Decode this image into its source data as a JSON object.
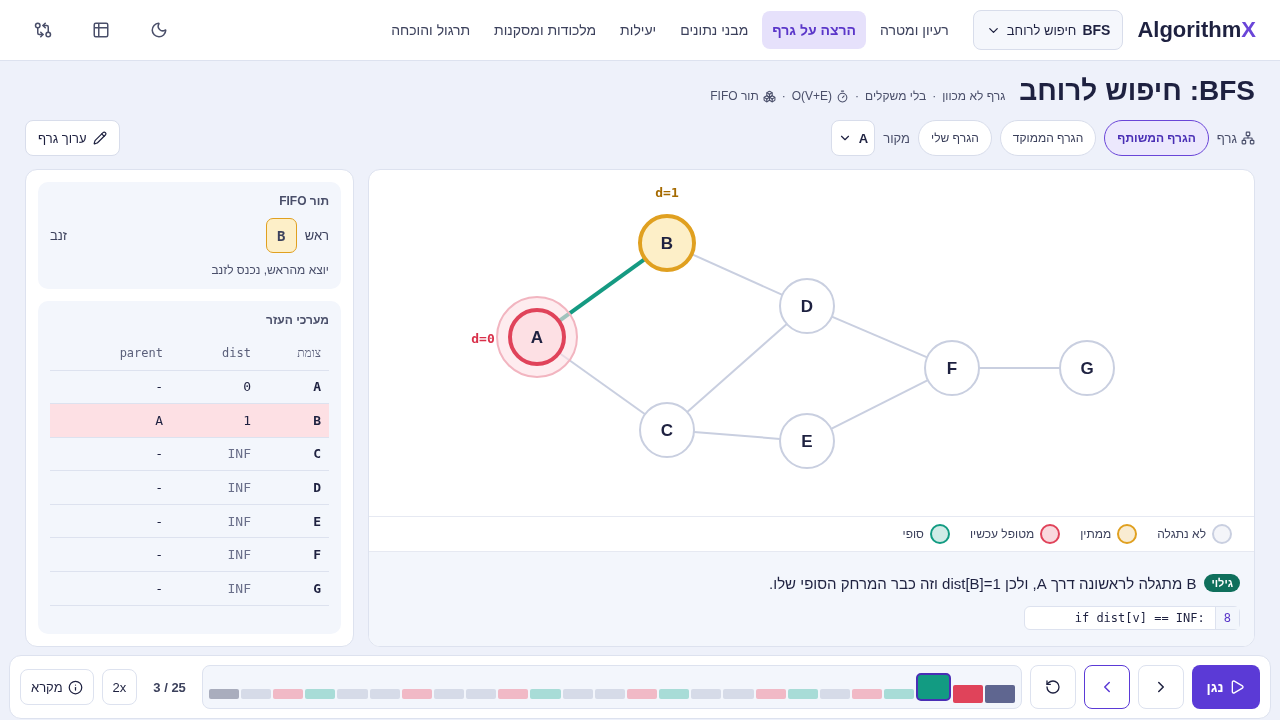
{
  "header": {
    "logo": {
      "text": "Algorithm",
      "accent": "X"
    },
    "algorithm_select": {
      "code": "BFS",
      "name": "חיפוש לרוחב"
    },
    "tabs": [
      {
        "label": "רעיון ומטרה",
        "selected": false
      },
      {
        "label": "הרצה על גרף",
        "selected": true
      },
      {
        "label": "מבני נתונים",
        "selected": false
      },
      {
        "label": "יעילות",
        "selected": false
      },
      {
        "label": "מלכודות ומסקנות",
        "selected": false
      },
      {
        "label": "תרגול והוכחה",
        "selected": false
      }
    ]
  },
  "title": "BFS: חיפוש לרוחב",
  "meta": [
    {
      "kind": "text",
      "text": "גרף לא מכוון"
    },
    {
      "kind": "dot",
      "text": "·"
    },
    {
      "kind": "text",
      "text": "בלי משקלים"
    },
    {
      "kind": "dot",
      "text": "·"
    },
    {
      "kind": "timer",
      "text": "O(V+E)"
    },
    {
      "kind": "dot",
      "text": "·"
    },
    {
      "kind": "queue",
      "text": "תור FIFO"
    }
  ],
  "graph_controls": {
    "label": "גרף",
    "options": [
      {
        "label": "הגרף המשותף",
        "selected": true
      },
      {
        "label": "הגרף הממוקד",
        "selected": false
      },
      {
        "label": "הגרף שלי",
        "selected": false
      }
    ],
    "source_label": "מקור",
    "source_value": "A",
    "edit_button": "ערוך גרף"
  },
  "queue": {
    "title": "תור FIFO",
    "head_label": "ראש",
    "items": [
      "B"
    ],
    "tail_label": "זנב",
    "note": "יוצא מהראש, נכנס לזנב"
  },
  "arrays": {
    "title": "מערכי העזר",
    "columns": [
      "צומת",
      "dist",
      "parent"
    ],
    "rows": [
      {
        "cells": [
          "A",
          "0",
          "-"
        ],
        "selected": false
      },
      {
        "cells": [
          "B",
          "1",
          "A"
        ],
        "selected": true
      },
      {
        "cells": [
          "C",
          "INF",
          "-"
        ],
        "selected": false
      },
      {
        "cells": [
          "D",
          "INF",
          "-"
        ],
        "selected": false
      },
      {
        "cells": [
          "E",
          "INF",
          "-"
        ],
        "selected": false
      },
      {
        "cells": [
          "F",
          "INF",
          "-"
        ],
        "selected": false
      },
      {
        "cells": [
          "G",
          "INF",
          "-"
        ],
        "selected": false
      }
    ]
  },
  "graph": {
    "nodes": [
      {
        "label": "A",
        "kind": "current",
        "dist_label": "d=0"
      },
      {
        "label": "B",
        "kind": "waiting",
        "dist_label": "d=1"
      },
      {
        "label": "C",
        "kind": "undiscovered"
      },
      {
        "label": "D",
        "kind": "undiscovered"
      },
      {
        "label": "E",
        "kind": "undiscovered"
      },
      {
        "label": "F",
        "kind": "undiscovered"
      },
      {
        "label": "G",
        "kind": "undiscovered"
      }
    ],
    "edges": [
      {
        "kind": "tree"
      },
      {
        "kind": "plain"
      },
      {
        "kind": "plain"
      },
      {
        "kind": "plain"
      },
      {
        "kind": "plain"
      },
      {
        "kind": "plain"
      },
      {
        "kind": "plain"
      },
      {
        "kind": "plain"
      }
    ]
  },
  "legend": [
    {
      "label": "לא נתגלה",
      "color": "#c9cfe0"
    },
    {
      "label": "ממתין",
      "color": "#e0a020"
    },
    {
      "label": "מטופל עכשיו",
      "color": "#e0435a"
    },
    {
      "label": "סופי",
      "color": "#129b82"
    }
  ],
  "explanation": {
    "badge": "גילוי",
    "text": "B מתגלה לראשונה דרך A, ולכן dist[B]=1 וזה כבר המרחק הסופי שלו.",
    "code_line_number": "8",
    "code": "if dist[v] == INF:"
  },
  "player": {
    "play_button": "נגן",
    "position": "3 / 25",
    "speed": "2x",
    "legend_button": "מקרא",
    "steps": [
      {
        "color": "#5f6690",
        "selected": false
      },
      {
        "color": "#e0435a",
        "selected": false
      },
      {
        "color": "#129b82",
        "selected": true
      },
      {
        "color": "#a8dcd7",
        "selected": false
      },
      {
        "color": "#f1b9c6",
        "selected": false
      },
      {
        "color": "#d6dbe8",
        "selected": false
      },
      {
        "color": "#a8dcd7",
        "selected": false
      },
      {
        "color": "#f1b9c6",
        "selected": false
      },
      {
        "color": "#d6dbe8",
        "selected": false
      },
      {
        "color": "#d6dbe8",
        "selected": false
      },
      {
        "color": "#a8dcd7",
        "selected": false
      },
      {
        "color": "#f1b9c6",
        "selected": false
      },
      {
        "color": "#d6dbe8",
        "selected": false
      },
      {
        "color": "#d6dbe8",
        "selected": false
      },
      {
        "color": "#a8dcd7",
        "selected": false
      },
      {
        "color": "#f1b9c6",
        "selected": false
      },
      {
        "color": "#d6dbe8",
        "selected": false
      },
      {
        "color": "#d6dbe8",
        "selected": false
      },
      {
        "color": "#f1b9c6",
        "selected": false
      },
      {
        "color": "#d6dbe8",
        "selected": false
      },
      {
        "color": "#d6dbe8",
        "selected": false
      },
      {
        "color": "#a8dcd7",
        "selected": false
      },
      {
        "color": "#f1b9c6",
        "selected": false
      },
      {
        "color": "#d6dbe8",
        "selected": false
      },
      {
        "color": "#a9adbd",
        "selected": false
      }
    ]
  }
}
